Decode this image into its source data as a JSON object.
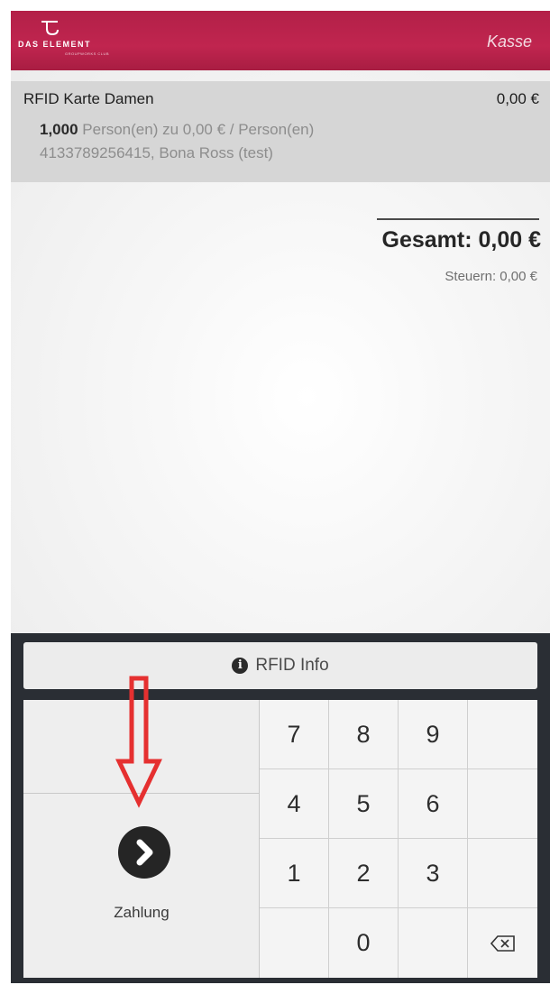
{
  "header": {
    "logo_text": "DAS ELEMENT",
    "logo_subtext": "GROUPWORKS CLUB",
    "title": "Kasse"
  },
  "receipt": {
    "item": {
      "name": "RFID Karte Damen",
      "price": "0,00 €",
      "quantity": "1,000",
      "quantity_suffix": " Person(en) zu 0,00 € / Person(en)",
      "customer": "4133789256415, Bona Ross (test)"
    },
    "total": "Gesamt: 0,00 €",
    "tax": "Steuern: 0,00 €"
  },
  "actions": {
    "rfid_info_label": "RFID Info",
    "payment_label": "Zahlung"
  },
  "keypad": {
    "keys": [
      "7",
      "8",
      "9",
      "",
      "4",
      "5",
      "6",
      "",
      "1",
      "2",
      "3",
      "",
      "",
      "0",
      "",
      "backspace"
    ]
  },
  "colors": {
    "header": "#b32048",
    "keypad_background": "#2a2e34",
    "annotation": "#e53030"
  },
  "icons": {
    "rfid_info": "info-icon",
    "payment": "chevron-right-icon",
    "backspace": "backspace-icon"
  }
}
